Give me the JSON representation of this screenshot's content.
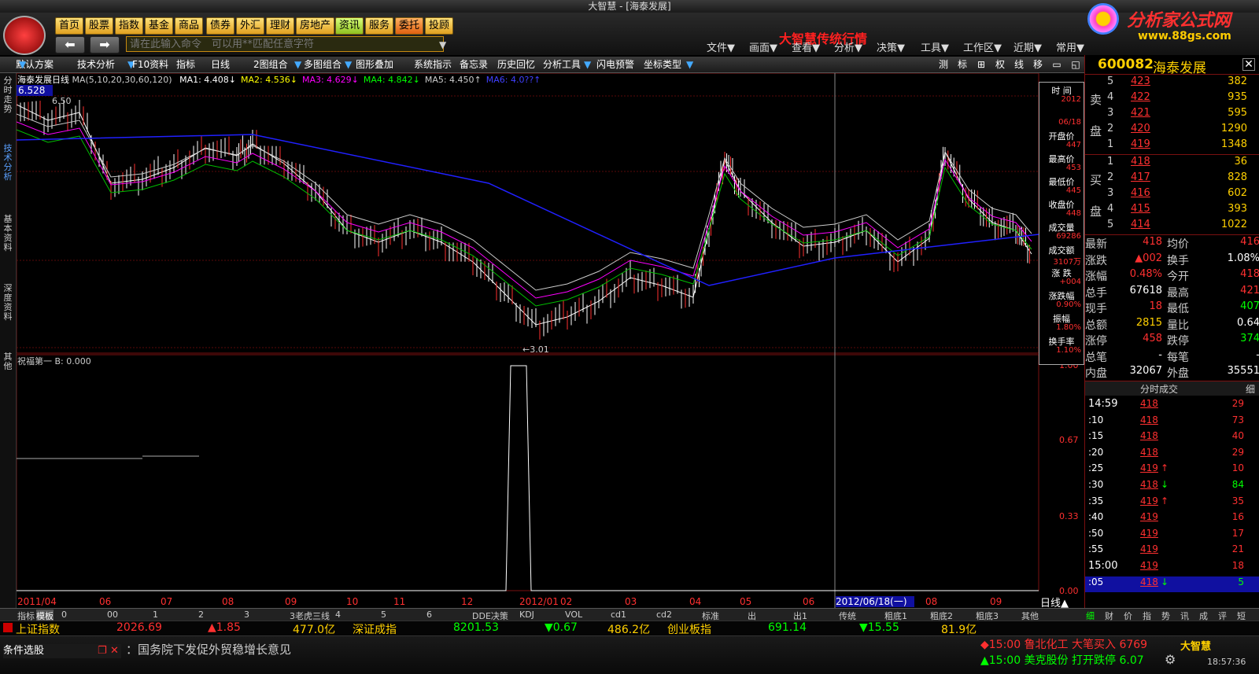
{
  "window": {
    "title": "大智慧 - [海泰发展]"
  },
  "toolbar": {
    "nav": [
      "首页",
      "股票",
      "指数",
      "基金",
      "商品",
      "债券",
      "外汇",
      "理财",
      "房地产",
      "资讯",
      "服务",
      "委托",
      "投顾"
    ],
    "command_placeholder": "请在此输入命令　可以用**匹配任意字符",
    "brand": "大智慧传统行情",
    "menus": [
      "文件▼",
      "画面▼",
      "查看▼",
      "分析▼",
      "决策▼",
      "工具▼",
      "工作区▼",
      "近期▼",
      "常用▼"
    ],
    "logo_text": "分析家公式网",
    "logo_url": "www.88gs.com"
  },
  "chart_toolbar": {
    "items": [
      "默认方案",
      "技术分析",
      "F10资料",
      "指标",
      "日线",
      "2图组合",
      "多图组合",
      "图形叠加",
      "系统指示",
      "备忘录",
      "历史回忆",
      "分析工具",
      "闪电预警",
      "坐标类型"
    ],
    "right_items": [
      "测",
      "标",
      "⊞",
      "权",
      "线",
      "移",
      "▭",
      "◱"
    ]
  },
  "side_tabs": [
    "分时走势",
    "技术分析",
    "基本资料",
    "深度资料",
    "其他"
  ],
  "chart": {
    "stock_label": "海泰发展",
    "period": "日线",
    "ma_params": "MA(5,10,20,30,60,120)",
    "ma_values": [
      {
        "label": "MA1: 4.408↓",
        "color": "#ffffff"
      },
      {
        "label": "MA2: 4.536↓",
        "color": "#ffff00"
      },
      {
        "label": "MA3: 4.629↓",
        "color": "#ff00ff"
      },
      {
        "label": "MA4: 4.842↓",
        "color": "#00ff00"
      },
      {
        "label": "MA5: 4.450↑",
        "color": "#cccccc"
      },
      {
        "label": "MA6: 4.0??↑",
        "color": "#4040ff"
      }
    ],
    "top_price": "6.528",
    "high_mark": "6.50",
    "low_mark": "←3.01",
    "indicator_line": "祝福第一  B: 0.000",
    "ind_axis": [
      "1.00",
      "0.67",
      "0.33",
      "0.00"
    ],
    "x_labels": [
      "2011/04",
      "06",
      "07",
      "08",
      "09",
      "10",
      "11",
      "12",
      "2012/01",
      "02",
      "03",
      "04",
      "05",
      "06",
      "07",
      "08",
      "09"
    ],
    "cursor_date": "2012/06/18(一)",
    "period_badge": "日线▲"
  },
  "data_window": {
    "rows": [
      {
        "label": "时 间",
        "value": "2012"
      },
      {
        "label": "",
        "value": "06/18"
      },
      {
        "label": "开盘价",
        "value": "447"
      },
      {
        "label": "最高价",
        "value": "453"
      },
      {
        "label": "最低价",
        "value": "445"
      },
      {
        "label": "收盘价",
        "value": "448"
      },
      {
        "label": "成交量",
        "value": "69286"
      },
      {
        "label": "成交额",
        "value": "3107万"
      },
      {
        "label": "涨 跌",
        "value": "+004"
      },
      {
        "label": "涨跌幅",
        "value": "0.90%"
      },
      {
        "label": "振幅",
        "value": "1.80%"
      },
      {
        "label": "换手率",
        "value": "1.10%"
      }
    ]
  },
  "quote": {
    "code": "600082",
    "name": "海泰发展",
    "sell_label": [
      "卖",
      "盘"
    ],
    "buy_label": [
      "买",
      "盘"
    ],
    "sell": [
      {
        "lvl": "5",
        "price": "423",
        "vol": "382"
      },
      {
        "lvl": "4",
        "price": "422",
        "vol": "935"
      },
      {
        "lvl": "3",
        "price": "421",
        "vol": "595"
      },
      {
        "lvl": "2",
        "price": "420",
        "vol": "1290"
      },
      {
        "lvl": "1",
        "price": "419",
        "vol": "1348"
      }
    ],
    "buy": [
      {
        "lvl": "1",
        "price": "418",
        "vol": "36"
      },
      {
        "lvl": "2",
        "price": "417",
        "vol": "828"
      },
      {
        "lvl": "3",
        "price": "416",
        "vol": "602"
      },
      {
        "lvl": "4",
        "price": "415",
        "vol": "393"
      },
      {
        "lvl": "5",
        "price": "414",
        "vol": "1022"
      }
    ],
    "stats": [
      {
        "l1": "最新",
        "v1": "418",
        "c1": "#ff3030",
        "l2": "均价",
        "v2": "416",
        "c2": "#ff3030"
      },
      {
        "l1": "涨跌",
        "v1": "▲002",
        "c1": "#ff3030",
        "l2": "换手",
        "v2": "1.08%",
        "c2": "#ffffff"
      },
      {
        "l1": "涨幅",
        "v1": "0.48%",
        "c1": "#ff3030",
        "l2": "今开",
        "v2": "418",
        "c2": "#ff3030"
      },
      {
        "l1": "总手",
        "v1": "67618",
        "c1": "#ffffff",
        "l2": "最高",
        "v2": "421",
        "c2": "#ff3030"
      },
      {
        "l1": "现手",
        "v1": "18",
        "c1": "#ff3030",
        "l2": "最低",
        "v2": "407",
        "c2": "#00ff00"
      },
      {
        "l1": "总额",
        "v1": "2815",
        "c1": "#ffd000",
        "l2": "量比",
        "v2": "0.64",
        "c2": "#ffffff"
      },
      {
        "l1": "涨停",
        "v1": "458",
        "c1": "#ff3030",
        "l2": "跌停",
        "v2": "374",
        "c2": "#00ff00"
      },
      {
        "l1": "总笔",
        "v1": "-",
        "c1": "#ffffff",
        "l2": "每笔",
        "v2": "-",
        "c2": "#ffffff"
      },
      {
        "l1": "内盘",
        "v1": "32067",
        "c1": "#ffffff",
        "l2": "外盘",
        "v2": "35551",
        "c2": "#ffffff"
      }
    ],
    "ticks_header": "分时成交",
    "ticks_header_right": "细",
    "ticks": [
      {
        "time": "14:59",
        "price": "418",
        "arrow": "",
        "vol": "29"
      },
      {
        "time": ":10",
        "price": "418",
        "arrow": "",
        "vol": "73"
      },
      {
        "time": ":15",
        "price": "418",
        "arrow": "",
        "vol": "40"
      },
      {
        "time": ":20",
        "price": "418",
        "arrow": "",
        "vol": "29"
      },
      {
        "time": ":25",
        "price": "419",
        "arrow": "↑",
        "vol": "10"
      },
      {
        "time": ":30",
        "price": "418",
        "arrow": "↓",
        "vol": "84"
      },
      {
        "time": ":35",
        "price": "419",
        "arrow": "↑",
        "vol": "35"
      },
      {
        "time": ":40",
        "price": "419",
        "arrow": "",
        "vol": "16"
      },
      {
        "time": ":50",
        "price": "419",
        "arrow": "",
        "vol": "17"
      },
      {
        "time": ":55",
        "price": "419",
        "arrow": "",
        "vol": "21"
      },
      {
        "time": "15:00",
        "price": "419",
        "arrow": "",
        "vol": "18"
      },
      {
        "time": ":05",
        "price": "418",
        "arrow": "↓",
        "vol": "5"
      }
    ],
    "bottom_tabs": [
      "细",
      "财",
      "价",
      "指",
      "势",
      "讯",
      "成",
      "评",
      "短"
    ]
  },
  "bottom_tabs": [
    "指标",
    "模板",
    "0",
    "00",
    "1",
    "2",
    "3",
    "3老虎三线",
    "4",
    "5",
    "6",
    "DDE决策",
    "KDJ",
    "VOL",
    "cd1",
    "cd2",
    "标准",
    "出",
    "出1",
    "传统",
    "粗底1",
    "粗底2",
    "粗底3",
    "其他"
  ],
  "index_bar": [
    {
      "name": "上证指数",
      "value": "2026.69",
      "chg": "▲1.85",
      "amt": "477.0亿"
    },
    {
      "name": "深证成指",
      "value": "8201.53",
      "chg": "▼0.67",
      "amt": "486.2亿"
    },
    {
      "name": "创业板指",
      "value": "691.14",
      "chg": "▼15.55",
      "amt": "81.9亿"
    }
  ],
  "news": {
    "left_label": "条件选股",
    "headline": "国务院下发促外贸稳增长意见",
    "alerts": [
      {
        "text": "◆15:00 鲁北化工 大笔买入 6769",
        "color": "#ff3030"
      },
      {
        "text": "▲15:00 美克股份 打开跌停 6.07",
        "color": "#00ff00"
      }
    ],
    "clock": "18:57:36",
    "app": "大智慧"
  }
}
